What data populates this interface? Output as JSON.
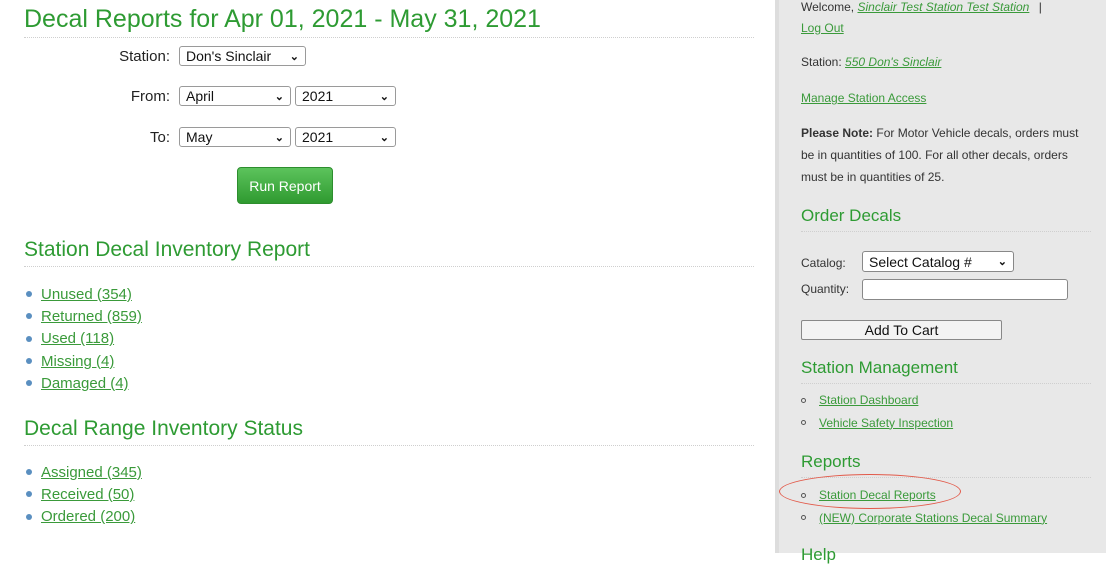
{
  "main": {
    "title": "Decal Reports for Apr 01, 2021 - May 31, 2021",
    "form": {
      "station_label": "Station:",
      "station_value": "Don's Sinclair",
      "from_label": "From:",
      "from_month": "April",
      "from_year": "2021",
      "to_label": "To:",
      "to_month": "May",
      "to_year": "2021",
      "run_button": "Run Report"
    },
    "inventory_report": {
      "title": "Station Decal Inventory Report",
      "items": [
        {
          "label": "Unused (354)"
        },
        {
          "label": "Returned (859)"
        },
        {
          "label": "Used (118)"
        },
        {
          "label": "Missing (4)"
        },
        {
          "label": "Damaged (4)"
        }
      ]
    },
    "range_status": {
      "title": "Decal Range Inventory Status",
      "items": [
        {
          "label": "Assigned (345)"
        },
        {
          "label": "Received (50)"
        },
        {
          "label": "Ordered (200)"
        }
      ]
    }
  },
  "sidebar": {
    "welcome_prefix": "Welcome,",
    "user_name": "Sinclair Test Station Test Station",
    "separator": "|",
    "logout": "Log Out",
    "station_prefix": "Station:",
    "station_link": "550 Don's Sinclair",
    "manage_access": "Manage Station Access",
    "note_bold": "Please Note:",
    "note_text": " For Motor Vehicle decals, orders must be in quantities of 100. For all other decals, orders must be in quantities of 25.",
    "order_decals": {
      "title": "Order Decals",
      "catalog_label": "Catalog:",
      "catalog_value": "Select Catalog #",
      "quantity_label": "Quantity:",
      "quantity_value": "",
      "add_button": "Add To Cart"
    },
    "station_management": {
      "title": "Station Management",
      "items": [
        {
          "label": "Station Dashboard"
        },
        {
          "label": "Vehicle Safety Inspection"
        }
      ]
    },
    "reports": {
      "title": "Reports",
      "items": [
        {
          "label": "Station Decal Reports"
        },
        {
          "label": "(NEW) Corporate Stations Decal Summary"
        }
      ]
    },
    "help_title": "Help"
  },
  "colors": {
    "brand_green": "#2e9b33",
    "link_green": "#3a9a3a",
    "highlight_red": "#e25a4a",
    "sidebar_bg": "#e8e8e8"
  }
}
